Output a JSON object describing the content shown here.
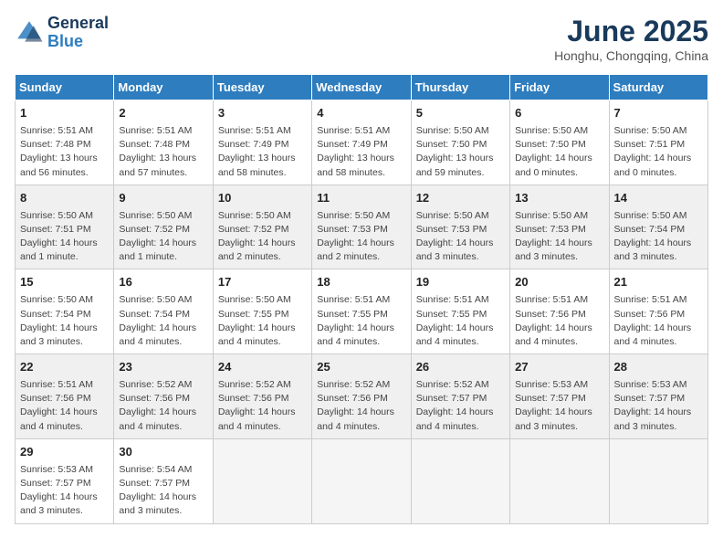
{
  "header": {
    "logo_line1": "General",
    "logo_line2": "Blue",
    "month": "June 2025",
    "location": "Honghu, Chongqing, China"
  },
  "weekdays": [
    "Sunday",
    "Monday",
    "Tuesday",
    "Wednesday",
    "Thursday",
    "Friday",
    "Saturday"
  ],
  "weeks": [
    [
      {
        "day": "1",
        "info": "Sunrise: 5:51 AM\nSunset: 7:48 PM\nDaylight: 13 hours\nand 56 minutes."
      },
      {
        "day": "2",
        "info": "Sunrise: 5:51 AM\nSunset: 7:48 PM\nDaylight: 13 hours\nand 57 minutes."
      },
      {
        "day": "3",
        "info": "Sunrise: 5:51 AM\nSunset: 7:49 PM\nDaylight: 13 hours\nand 58 minutes."
      },
      {
        "day": "4",
        "info": "Sunrise: 5:51 AM\nSunset: 7:49 PM\nDaylight: 13 hours\nand 58 minutes."
      },
      {
        "day": "5",
        "info": "Sunrise: 5:50 AM\nSunset: 7:50 PM\nDaylight: 13 hours\nand 59 minutes."
      },
      {
        "day": "6",
        "info": "Sunrise: 5:50 AM\nSunset: 7:50 PM\nDaylight: 14 hours\nand 0 minutes."
      },
      {
        "day": "7",
        "info": "Sunrise: 5:50 AM\nSunset: 7:51 PM\nDaylight: 14 hours\nand 0 minutes."
      }
    ],
    [
      {
        "day": "8",
        "info": "Sunrise: 5:50 AM\nSunset: 7:51 PM\nDaylight: 14 hours\nand 1 minute."
      },
      {
        "day": "9",
        "info": "Sunrise: 5:50 AM\nSunset: 7:52 PM\nDaylight: 14 hours\nand 1 minute."
      },
      {
        "day": "10",
        "info": "Sunrise: 5:50 AM\nSunset: 7:52 PM\nDaylight: 14 hours\nand 2 minutes."
      },
      {
        "day": "11",
        "info": "Sunrise: 5:50 AM\nSunset: 7:53 PM\nDaylight: 14 hours\nand 2 minutes."
      },
      {
        "day": "12",
        "info": "Sunrise: 5:50 AM\nSunset: 7:53 PM\nDaylight: 14 hours\nand 3 minutes."
      },
      {
        "day": "13",
        "info": "Sunrise: 5:50 AM\nSunset: 7:53 PM\nDaylight: 14 hours\nand 3 minutes."
      },
      {
        "day": "14",
        "info": "Sunrise: 5:50 AM\nSunset: 7:54 PM\nDaylight: 14 hours\nand 3 minutes."
      }
    ],
    [
      {
        "day": "15",
        "info": "Sunrise: 5:50 AM\nSunset: 7:54 PM\nDaylight: 14 hours\nand 3 minutes."
      },
      {
        "day": "16",
        "info": "Sunrise: 5:50 AM\nSunset: 7:54 PM\nDaylight: 14 hours\nand 4 minutes."
      },
      {
        "day": "17",
        "info": "Sunrise: 5:50 AM\nSunset: 7:55 PM\nDaylight: 14 hours\nand 4 minutes."
      },
      {
        "day": "18",
        "info": "Sunrise: 5:51 AM\nSunset: 7:55 PM\nDaylight: 14 hours\nand 4 minutes."
      },
      {
        "day": "19",
        "info": "Sunrise: 5:51 AM\nSunset: 7:55 PM\nDaylight: 14 hours\nand 4 minutes."
      },
      {
        "day": "20",
        "info": "Sunrise: 5:51 AM\nSunset: 7:56 PM\nDaylight: 14 hours\nand 4 minutes."
      },
      {
        "day": "21",
        "info": "Sunrise: 5:51 AM\nSunset: 7:56 PM\nDaylight: 14 hours\nand 4 minutes."
      }
    ],
    [
      {
        "day": "22",
        "info": "Sunrise: 5:51 AM\nSunset: 7:56 PM\nDaylight: 14 hours\nand 4 minutes."
      },
      {
        "day": "23",
        "info": "Sunrise: 5:52 AM\nSunset: 7:56 PM\nDaylight: 14 hours\nand 4 minutes."
      },
      {
        "day": "24",
        "info": "Sunrise: 5:52 AM\nSunset: 7:56 PM\nDaylight: 14 hours\nand 4 minutes."
      },
      {
        "day": "25",
        "info": "Sunrise: 5:52 AM\nSunset: 7:56 PM\nDaylight: 14 hours\nand 4 minutes."
      },
      {
        "day": "26",
        "info": "Sunrise: 5:52 AM\nSunset: 7:57 PM\nDaylight: 14 hours\nand 4 minutes."
      },
      {
        "day": "27",
        "info": "Sunrise: 5:53 AM\nSunset: 7:57 PM\nDaylight: 14 hours\nand 3 minutes."
      },
      {
        "day": "28",
        "info": "Sunrise: 5:53 AM\nSunset: 7:57 PM\nDaylight: 14 hours\nand 3 minutes."
      }
    ],
    [
      {
        "day": "29",
        "info": "Sunrise: 5:53 AM\nSunset: 7:57 PM\nDaylight: 14 hours\nand 3 minutes."
      },
      {
        "day": "30",
        "info": "Sunrise: 5:54 AM\nSunset: 7:57 PM\nDaylight: 14 hours\nand 3 minutes."
      },
      {
        "day": "",
        "info": ""
      },
      {
        "day": "",
        "info": ""
      },
      {
        "day": "",
        "info": ""
      },
      {
        "day": "",
        "info": ""
      },
      {
        "day": "",
        "info": ""
      }
    ]
  ]
}
